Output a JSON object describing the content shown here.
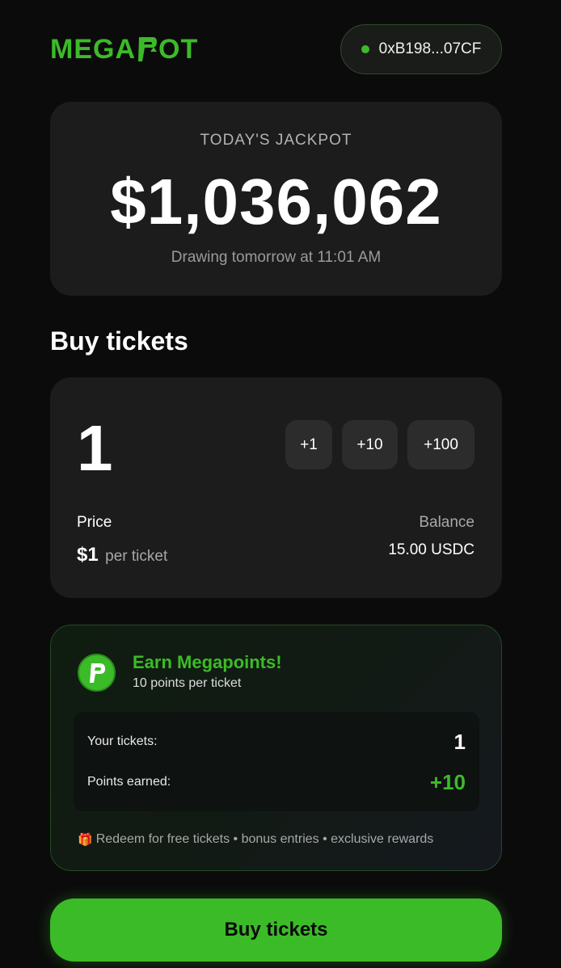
{
  "header": {
    "logo_text_left": "MEGA",
    "logo_text_right": "OT",
    "wallet_address": "0xB198...07CF",
    "wallet_status_color": "#3cbb28"
  },
  "jackpot": {
    "label": "TODAY'S JACKPOT",
    "amount": "$1,036,062",
    "drawing": "Drawing tomorrow at 11:01 AM"
  },
  "buy_section": {
    "title": "Buy tickets",
    "quantity": "1",
    "increments": [
      "+1",
      "+10",
      "+100"
    ],
    "price_label": "Price",
    "price_value": "$1",
    "price_unit": "per ticket",
    "balance_label": "Balance",
    "balance_value": "15.00 USDC"
  },
  "megapoints": {
    "title": "Earn Megapoints!",
    "subtitle": "10 points per ticket",
    "tickets_label": "Your tickets:",
    "tickets_value": "1",
    "points_label": "Points earned:",
    "points_value": "+10",
    "footer": "Redeem for free tickets • bonus entries • exclusive rewards",
    "footer_icon": "gift-icon"
  },
  "buy_button": {
    "label": "Buy tickets"
  },
  "colors": {
    "accent": "#3cbb28",
    "background": "#0b0b0b",
    "card": "#1c1c1c"
  }
}
